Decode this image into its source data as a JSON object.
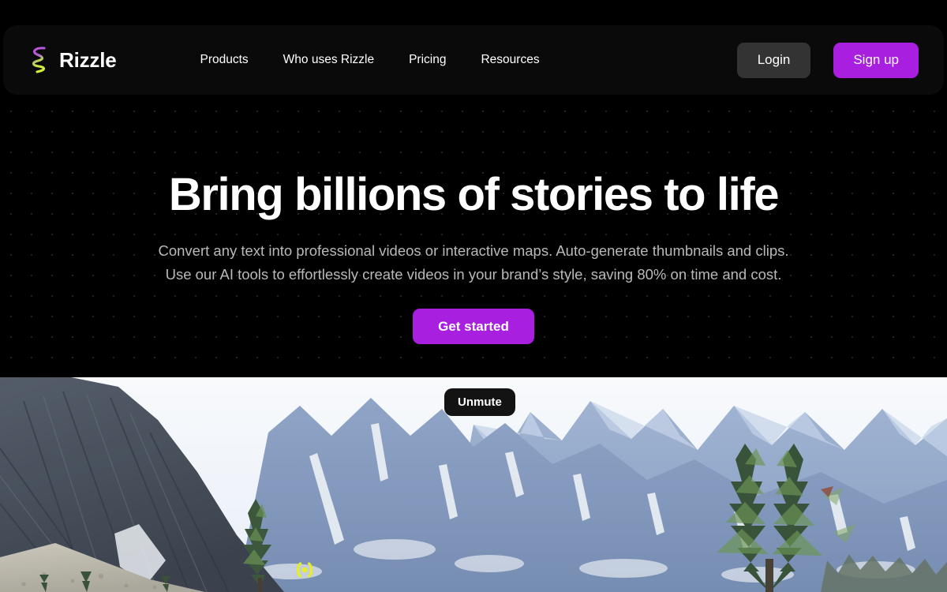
{
  "brand": {
    "name": "Rizzle",
    "logo_icon": "rizzle-squiggle-logo",
    "logo_gradient_top": "#b84fd8",
    "logo_gradient_bottom": "#d4e84a"
  },
  "nav": {
    "items": [
      {
        "label": "Products"
      },
      {
        "label": "Who uses Rizzle"
      },
      {
        "label": "Pricing"
      },
      {
        "label": "Resources"
      }
    ]
  },
  "auth": {
    "login_label": "Login",
    "signup_label": "Sign up",
    "login_bg": "#333333",
    "signup_bg": "#a81fe0"
  },
  "hero": {
    "title": "Bring billions of stories to life",
    "subtitle_line1": "Convert any text into professional videos or interactive maps. Auto-generate thumbnails and clips.",
    "subtitle_line2": "Use our AI tools to effortlessly create videos in your brand’s style, saving 80% on time and cost.",
    "cta_label": "Get started",
    "cta_bg": "#a81fe0",
    "title_color": "#ffffff",
    "subtitle_color": "#b9b9b9",
    "background_color": "#000000"
  },
  "video": {
    "unmute_label": "Unmute",
    "unmute_icon": "speaker-muted-icon",
    "audio_badge_icon": "audio-broadcast-icon",
    "audio_badge_color": "#e8ee22",
    "scene_description": "Snow-capped blue mountain range with rocky cliff and evergreen trees"
  }
}
